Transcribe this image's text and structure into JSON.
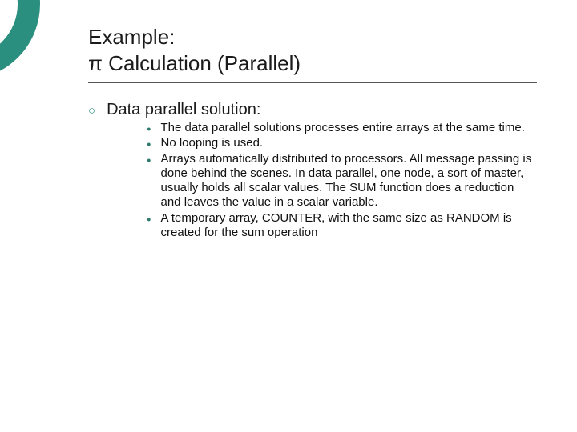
{
  "title": {
    "line1": "Example:",
    "line2": "π Calculation (Parallel)"
  },
  "body": {
    "heading": "Data parallel solution:",
    "points": [
      "The data parallel solutions processes entire arrays at the same time.",
      "No looping is used.",
      "Arrays automatically distributed to processors. All message passing is done behind the scenes. In data parallel, one node, a sort of master, usually holds all scalar values. The SUM function does a reduction and leaves the value in a scalar variable.",
      "A temporary array, COUNTER, with the same size as RANDOM is created for the sum operation"
    ]
  }
}
